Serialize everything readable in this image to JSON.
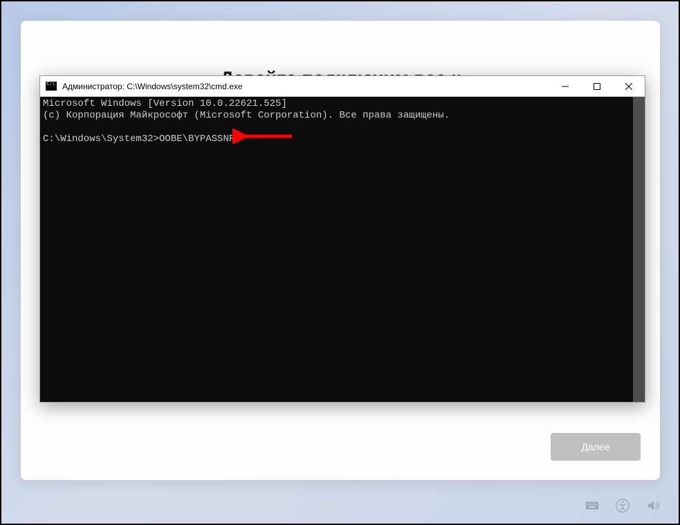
{
  "oobe": {
    "heading": "Давайте подключим вас к",
    "next_label": "Далее"
  },
  "cmd": {
    "title": "Администратор: C:\\Windows\\system32\\cmd.exe",
    "line1": "Microsoft Windows [Version 10.0.22621.525]",
    "line2": "(c) Корпорация Майкрософт (Microsoft Corporation). Все права защищены.",
    "prompt": "C:\\Windows\\System32>",
    "command": "OOBE\\BYPASSNRO"
  },
  "taskbar": {
    "keyboard": "keyboard",
    "accessibility": "accessibility",
    "volume": "volume"
  }
}
